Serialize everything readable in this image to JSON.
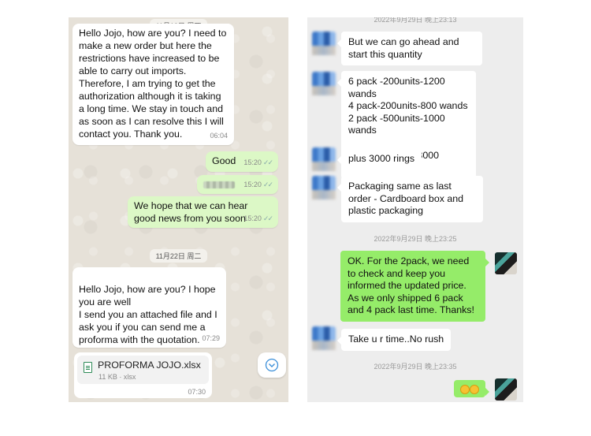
{
  "whatsapp": {
    "date_1": "11月10日 周四",
    "msg_1": {
      "text": "Hello Jojo, how are you?  I need to make a new order but here the restrictions have increased to be able to carry out imports. Therefore, I am trying to get the authorization although it is taking a long time.  We stay in touch and as soon as I can resolve this I will contact you.  Thank you.",
      "time": "06:04"
    },
    "msg_2": {
      "text": "Good",
      "time": "15:20"
    },
    "msg_3": {
      "time": "15:20"
    },
    "msg_4": {
      "text": "We hope that we can hear good news from you soon",
      "time": "15:20"
    },
    "date_2": "11月22日 周二",
    "msg_5": {
      "text": "Hello Jojo, how are you?  I hope you are well\nI send you an attached file and I ask you if you can send me a proforma with the quotation.",
      "time": "07:29"
    },
    "file": {
      "name": "PROFORMA JOJO.xlsx",
      "meta": "11 KB · xlsx",
      "time": "07:30"
    }
  },
  "wechat": {
    "timestamp_top": "2022年9月29日 晚上23:13",
    "msg_1": "But we can go ahead and start this quantity",
    "msg_2": "6 pack -200units-1200 wands\n4 pack-200units-800 wands\n2 pack -500units-1000 wands\n\nTotal 900 units -3000 wands",
    "msg_3": "plus 3000 rings",
    "msg_4": "Packaging same as last order - Cardboard box and plastic packaging",
    "timestamp_2": "2022年9月29日 晚上23:25",
    "msg_5": "OK. For the 2pack, we need to check and keep you informed the updated price. As we only shipped 6 pack and 4 pack last time. Thanks!",
    "msg_6": "Take u r time..No rush",
    "timestamp_3": "2022年9月29日 晚上23:35"
  },
  "colors": {
    "wa_outgoing": "#dcf8c6",
    "wa_background": "#e6e1d8",
    "wc_outgoing": "#95ec69",
    "wc_background": "#ededed"
  }
}
